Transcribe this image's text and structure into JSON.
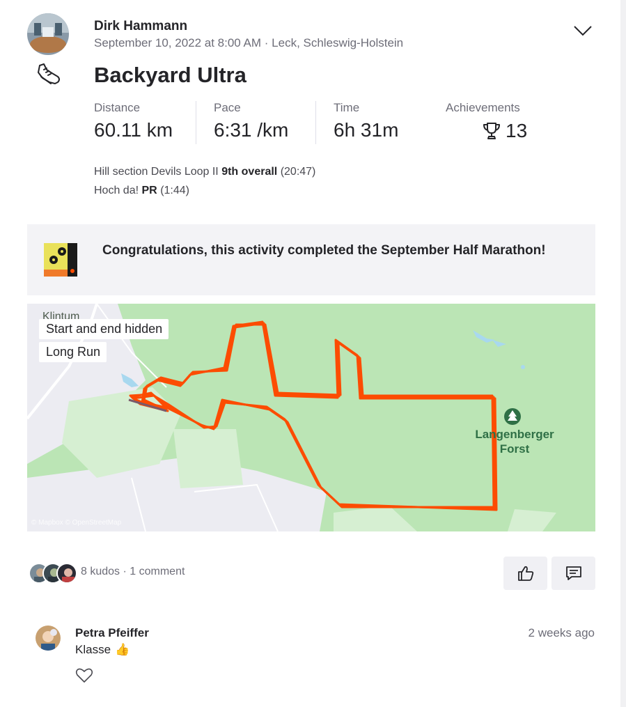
{
  "athlete": {
    "name": "Dirk Hammann"
  },
  "activity": {
    "date_location": "September 10, 2022 at 8:00 AM · Leck, Schleswig-Holstein",
    "title": "Backyard Ultra",
    "sport_icon": "running-shoe-icon"
  },
  "stats": [
    {
      "label": "Distance",
      "value": "60.11 km"
    },
    {
      "label": "Pace",
      "value": "6:31 /km"
    },
    {
      "label": "Time",
      "value": "6h 31m"
    }
  ],
  "achievements": {
    "label": "Achievements",
    "count": "13",
    "icon": "trophy-icon"
  },
  "segments": [
    {
      "name": "Hill section Devils Loop II",
      "rank": "9th overall",
      "time": "(20:47)"
    },
    {
      "name": "Hoch da!",
      "rank": "PR",
      "time": "(1:44)"
    }
  ],
  "challenge": {
    "text": "Congratulations, this activity completed the September Half Marathon!"
  },
  "map": {
    "tags": [
      "Start and end hidden",
      "Long Run"
    ],
    "place_name": "Klintum",
    "forest_label": "Langenberger Forst",
    "attribution": "© Mapbox © OpenStreetMap",
    "route_color": "#fc4c02",
    "land_color": "#bbe5b5"
  },
  "social": {
    "kudos": "8 kudos",
    "separator": "·",
    "comments": "1 comment",
    "kudos_button_icon": "thumbs-up-icon",
    "comment_button_icon": "comment-icon"
  },
  "comment": {
    "author": "Petra Pfeiffer",
    "time": "2 weeks ago",
    "text": "Klasse",
    "emoji": "👍"
  }
}
